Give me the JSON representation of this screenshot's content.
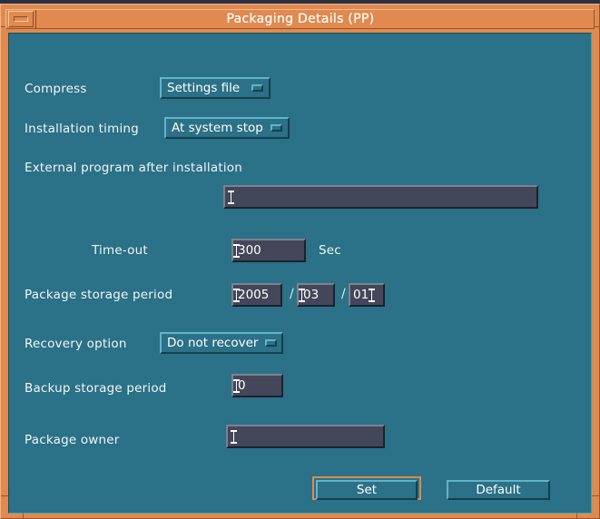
{
  "window": {
    "title": "Packaging Details (PP)",
    "menu_button_icon": "window-menu-icon",
    "accent_color": "#e08a50",
    "client_color": "#2b7187",
    "field_color": "#434759"
  },
  "form": {
    "compress": {
      "label": "Compress",
      "value": "Settings file",
      "glyph": "option-menu-indicator"
    },
    "installation_timing": {
      "label": "Installation timing",
      "value": "At system stop",
      "glyph": "option-menu-indicator"
    },
    "external_program": {
      "label": "External program after installation",
      "value": "",
      "caret": "text-caret"
    },
    "timeout": {
      "label": "Time-out",
      "value": "300",
      "unit": "Sec"
    },
    "package_storage_period": {
      "label": "Package storage period",
      "year": "2005",
      "month": "03",
      "day": "01",
      "separator": "/"
    },
    "recovery_option": {
      "label": "Recovery option",
      "value": "Do not recover",
      "glyph": "option-menu-indicator"
    },
    "backup_storage_period": {
      "label": "Backup storage period",
      "value": "0"
    },
    "package_owner": {
      "label": "Package owner",
      "value": ""
    }
  },
  "actions": {
    "set": "Set",
    "default": "Default"
  }
}
